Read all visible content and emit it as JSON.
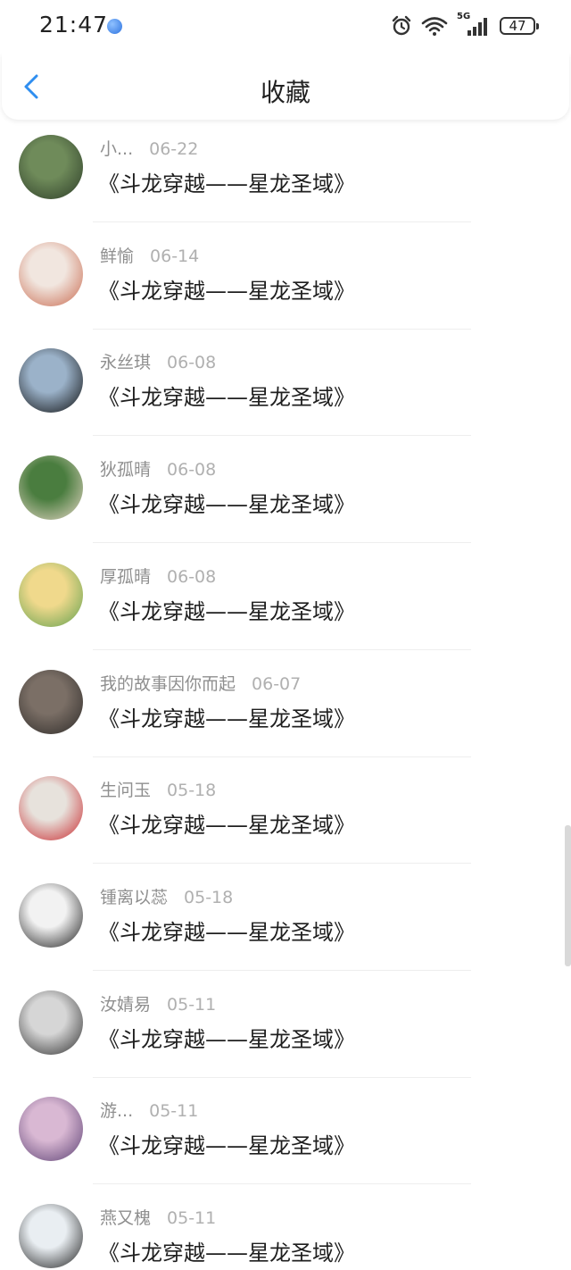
{
  "status_bar": {
    "time": "21:47",
    "network": "5G",
    "battery": "47"
  },
  "header": {
    "title": "收藏"
  },
  "items": [
    {
      "author": "小...",
      "date": "06-22",
      "title": "《斗龙穿越——星龙圣域》",
      "avatar_colors": [
        "#6f8b5a",
        "#2b3b27"
      ]
    },
    {
      "author": "鲜愉",
      "date": "06-14",
      "title": "《斗龙穿越——星龙圣域》",
      "avatar_colors": [
        "#f1e6df",
        "#c8684d"
      ]
    },
    {
      "author": "永丝琪",
      "date": "06-08",
      "title": "《斗龙穿越——星龙圣域》",
      "avatar_colors": [
        "#9bb2c9",
        "#0b0b0b"
      ]
    },
    {
      "author": "狄孤晴",
      "date": "06-08",
      "title": "《斗龙穿越——星龙圣域》",
      "avatar_colors": [
        "#4a7d3f",
        "#e9d8c8"
      ]
    },
    {
      "author": "厚孤晴",
      "date": "06-08",
      "title": "《斗龙穿越——星龙圣域》",
      "avatar_colors": [
        "#f0d98c",
        "#5f9f4d"
      ]
    },
    {
      "author": "我的故事因你而起",
      "date": "06-07",
      "title": "《斗龙穿越——星龙圣域》",
      "avatar_colors": [
        "#7b6f66",
        "#2d2a28"
      ]
    },
    {
      "author": "生问玉",
      "date": "05-18",
      "title": "《斗龙穿越——星龙圣域》",
      "avatar_colors": [
        "#e7e2dc",
        "#c8262b"
      ]
    },
    {
      "author": "锺离以蕊",
      "date": "05-18",
      "title": "《斗龙穿越——星龙圣域》",
      "avatar_colors": [
        "#f2f2f2",
        "#1a1a1a"
      ]
    },
    {
      "author": "汝婧易",
      "date": "05-11",
      "title": "《斗龙穿越——星龙圣域》",
      "avatar_colors": [
        "#d6d6d6",
        "#2c2c2c"
      ]
    },
    {
      "author": "游...",
      "date": "05-11",
      "title": "《斗龙穿越——星龙圣域》",
      "avatar_colors": [
        "#d9b8d3",
        "#5a3f72"
      ]
    },
    {
      "author": "燕又槐",
      "date": "05-11",
      "title": "《斗龙穿越——星龙圣域》",
      "avatar_colors": [
        "#e9eef2",
        "#1c1c1c"
      ]
    }
  ]
}
